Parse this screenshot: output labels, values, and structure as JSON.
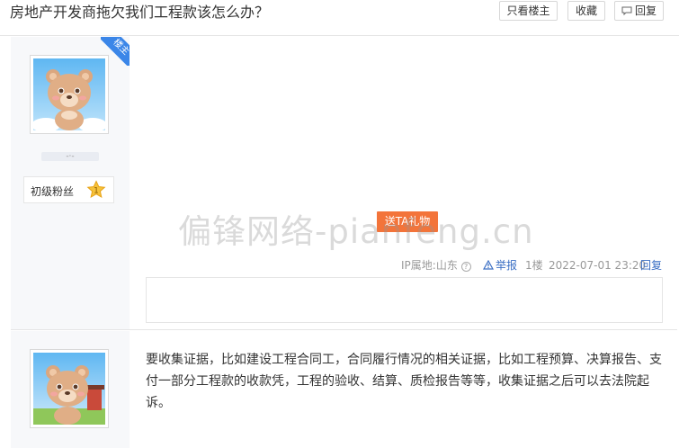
{
  "thread": {
    "title": "房地产开发商拖欠我们工程款该怎么办？",
    "only_op_label": "只看楼主",
    "favorite_label": "收藏",
    "reply_label": "回复"
  },
  "post1": {
    "op_badge": "楼主",
    "username": "-·-",
    "level_label": "初级粉丝",
    "level_number": "1",
    "gift_label": "送TA礼物",
    "ip_label": "IP属地:山东",
    "report_label": "举报",
    "floor": "1楼",
    "time": "2022-07-01 23:20",
    "reply_label": "回复"
  },
  "post2": {
    "content": "要收集证据，比如建设工程合同工，合同履行情况的相关证据，比如工程预算、决算报告、支付一部分工程款的收款凭，工程的验收、结算、质检报告等等，收集证据之后可以去法院起诉。"
  },
  "watermark": "偏锋网络-pianfeng.cn",
  "colors": {
    "accent_blue": "#3b86e8",
    "link_blue": "#3b6fc4",
    "gift_orange": "#f3743a"
  }
}
